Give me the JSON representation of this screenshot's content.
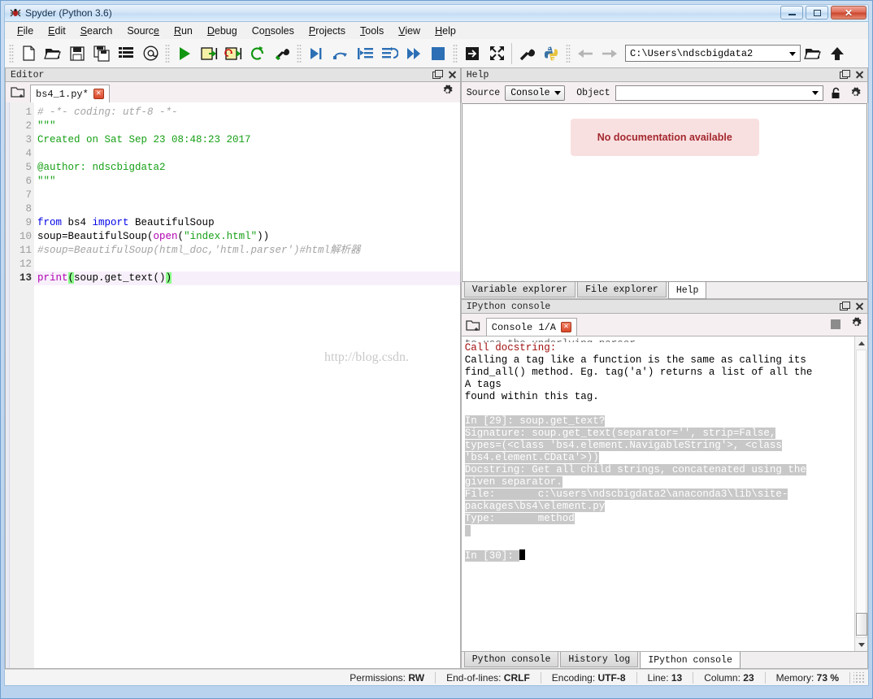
{
  "window": {
    "title": "Spyder (Python 3.6)",
    "icon": "spider-icon",
    "minimize": "–",
    "maximize": "□",
    "close": "✕"
  },
  "menubar": {
    "items": [
      {
        "label": "File",
        "mnemonic": "F"
      },
      {
        "label": "Edit",
        "mnemonic": "E"
      },
      {
        "label": "Search",
        "mnemonic": "S"
      },
      {
        "label": "Source",
        "mnemonic": "e"
      },
      {
        "label": "Run",
        "mnemonic": "R"
      },
      {
        "label": "Debug",
        "mnemonic": "D"
      },
      {
        "label": "Consoles",
        "mnemonic": "n"
      },
      {
        "label": "Projects",
        "mnemonic": "P"
      },
      {
        "label": "Tools",
        "mnemonic": "T"
      },
      {
        "label": "View",
        "mnemonic": "V"
      },
      {
        "label": "Help",
        "mnemonic": "H"
      }
    ]
  },
  "toolbar": {
    "groups": [
      [
        "new-file-icon",
        "open-file-icon",
        "save-file-icon",
        "save-all-icon",
        "list-icon",
        "at-icon"
      ],
      [
        "run-icon",
        "run-cell-icon",
        "run-cell-advance-icon",
        "rerun-icon",
        "configure-run-icon"
      ],
      [
        "debug-icon",
        "step-over-icon",
        "step-into-icon",
        "step-return-icon",
        "continue-icon",
        "stop-debug-icon"
      ],
      [
        "maximize-pane-icon",
        "fullscreen-icon",
        "preferences-icon",
        "python-path-icon"
      ]
    ],
    "back_label": "back-arrow-icon",
    "forward_label": "forward-arrow-icon",
    "path_value": "C:\\Users\\ndscbigdata2",
    "browse_label": "open-folder-icon",
    "parent_label": "up-arrow-icon"
  },
  "editor_pane": {
    "title": "Editor",
    "browse_tabs_icon": "browse-tabs-icon",
    "options_icon": "gear-icon",
    "undock_icon": "undock-icon",
    "close_icon": "close-icon",
    "tabs": [
      {
        "label": "bs4_1.py*",
        "close": "✕",
        "active": true
      }
    ],
    "code_lines": [
      {
        "n": 1,
        "tokens": [
          {
            "t": "# -*- coding: utf-8 -*-",
            "c": "c-comment"
          }
        ]
      },
      {
        "n": 2,
        "tokens": [
          {
            "t": "\"\"\"",
            "c": "c-string"
          }
        ]
      },
      {
        "n": 3,
        "tokens": [
          {
            "t": "Created on Sat Sep 23 08:48:23 2017",
            "c": "c-string"
          }
        ]
      },
      {
        "n": 4,
        "tokens": []
      },
      {
        "n": 5,
        "tokens": [
          {
            "t": "@author: ndscbigdata2",
            "c": "c-string"
          }
        ]
      },
      {
        "n": 6,
        "tokens": [
          {
            "t": "\"\"\"",
            "c": "c-string"
          }
        ]
      },
      {
        "n": 7,
        "tokens": []
      },
      {
        "n": 8,
        "tokens": []
      },
      {
        "n": 9,
        "tokens": [
          {
            "t": "from",
            "c": "c-kw"
          },
          {
            "t": " bs4 ",
            "c": ""
          },
          {
            "t": "import",
            "c": "c-kw"
          },
          {
            "t": " BeautifulSoup",
            "c": ""
          }
        ]
      },
      {
        "n": 10,
        "tokens": [
          {
            "t": "soup=BeautifulSoup(",
            "c": ""
          },
          {
            "t": "open",
            "c": "c-builtin"
          },
          {
            "t": "(",
            "c": ""
          },
          {
            "t": "\"index.html\"",
            "c": "c-string"
          },
          {
            "t": "))",
            "c": ""
          }
        ]
      },
      {
        "n": 11,
        "tokens": [
          {
            "t": "#soup=BeautifulSoup(html_doc,'html.parser')#html解析器",
            "c": "c-comment"
          }
        ]
      },
      {
        "n": 12,
        "tokens": []
      },
      {
        "n": 13,
        "tokens": [
          {
            "t": "print",
            "c": "c-fn"
          },
          {
            "t": "(",
            "c": "c-match"
          },
          {
            "t": "soup.get_text()",
            "c": ""
          },
          {
            "t": ")",
            "c": "c-match"
          }
        ],
        "highlight": true
      }
    ]
  },
  "help_pane": {
    "title": "Help",
    "undock_icon": "undock-icon",
    "close_icon": "close-icon",
    "source_label": "Source",
    "source_value": "Console",
    "object_label": "Object",
    "object_value": "",
    "lock_icon": "lock-icon",
    "options_icon": "gear-icon",
    "message": "No documentation available",
    "message_color": "#a3282f",
    "tabs": [
      {
        "label": "Variable explorer",
        "active": false
      },
      {
        "label": "File explorer",
        "active": false
      },
      {
        "label": "Help",
        "active": true
      }
    ]
  },
  "console_pane": {
    "title": "IPython console",
    "undock_icon": "undock-icon",
    "close_icon": "close-icon",
    "browse_tabs_icon": "browse-tabs-icon",
    "stop_icon": "stop-icon",
    "options_icon": "gear-icon",
    "tabs": [
      {
        "label": "Console 1/A",
        "close": "✕",
        "active": true
      }
    ],
    "output": [
      {
        "text": "to use the underlying parser.",
        "style": "cut"
      },
      {
        "text": "Call docstring:",
        "style": "err"
      },
      {
        "text": "Calling a tag like a function is the same as calling its",
        "style": "plain"
      },
      {
        "text": "find_all() method. Eg. tag('a') returns a list of all the",
        "style": "plain"
      },
      {
        "text": "A tags",
        "style": "plain"
      },
      {
        "text": "found within this tag.",
        "style": "plain"
      },
      {
        "text": "",
        "style": "plain"
      },
      {
        "text": "In [29]: soup.get_text?",
        "style": "sel"
      },
      {
        "text": "Signature: soup.get_text(separator='', strip=False,",
        "style": "sel"
      },
      {
        "text": "types=(<class 'bs4.element.NavigableString'>, <class",
        "style": "sel"
      },
      {
        "text": "'bs4.element.CData'>))",
        "style": "sel"
      },
      {
        "text": "Docstring: Get all child strings, concatenated using the",
        "style": "sel"
      },
      {
        "text": "given separator.",
        "style": "sel"
      },
      {
        "text": "File:       c:\\users\\ndscbigdata2\\anaconda3\\lib\\site-",
        "style": "sel"
      },
      {
        "text": "packages\\bs4\\element.py",
        "style": "sel"
      },
      {
        "text": "Type:       method",
        "style": "sel"
      },
      {
        "text": " ",
        "style": "sel"
      },
      {
        "text": "",
        "style": "plain"
      },
      {
        "text": "In [30]: ",
        "style": "sel-prompt"
      }
    ],
    "tabs_bottom": [
      {
        "label": "Python console",
        "active": false
      },
      {
        "label": "History log",
        "active": false
      },
      {
        "label": "IPython console",
        "active": true
      }
    ]
  },
  "statusbar": {
    "items": [
      {
        "label": "Permissions:",
        "value": "RW"
      },
      {
        "label": "End-of-lines:",
        "value": "CRLF"
      },
      {
        "label": "Encoding:",
        "value": "UTF-8"
      },
      {
        "label": "Line:",
        "value": "13"
      },
      {
        "label": "Column:",
        "value": "23"
      },
      {
        "label": "Memory:",
        "value": "73 %"
      }
    ]
  },
  "watermark": {
    "text": "http://blog.csdn."
  },
  "colors": {
    "accent": "#3b6ea5",
    "error": "#a3282f",
    "string": "#16a016",
    "keyword": "#0000e6",
    "comment": "#a3a3a3"
  }
}
